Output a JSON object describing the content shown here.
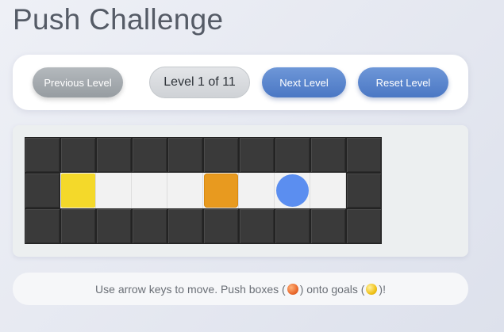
{
  "title": "Push Challenge",
  "controls": {
    "previous_label": "Previous Level",
    "level_text": "Level 1 of 11",
    "next_label": "Next Level",
    "reset_label": "Reset Level"
  },
  "board": {
    "cols": 10,
    "rows": 3,
    "layout": [
      "##########",
      "#.   B P #",
      "##########"
    ],
    "legend": {
      "#": "wall",
      " ": "floor",
      ".": "goal",
      "B": "box",
      "P": "player"
    },
    "colors": {
      "wall": "#3a3a3a",
      "floor": "#f2f2f2",
      "goal": "#f4d92a",
      "box": "#e89a1f",
      "player": "#5b8ef0"
    }
  },
  "instructions": {
    "part1": "Use arrow keys to move. Push boxes (",
    "part2": ") onto goals (",
    "part3": ")!"
  }
}
